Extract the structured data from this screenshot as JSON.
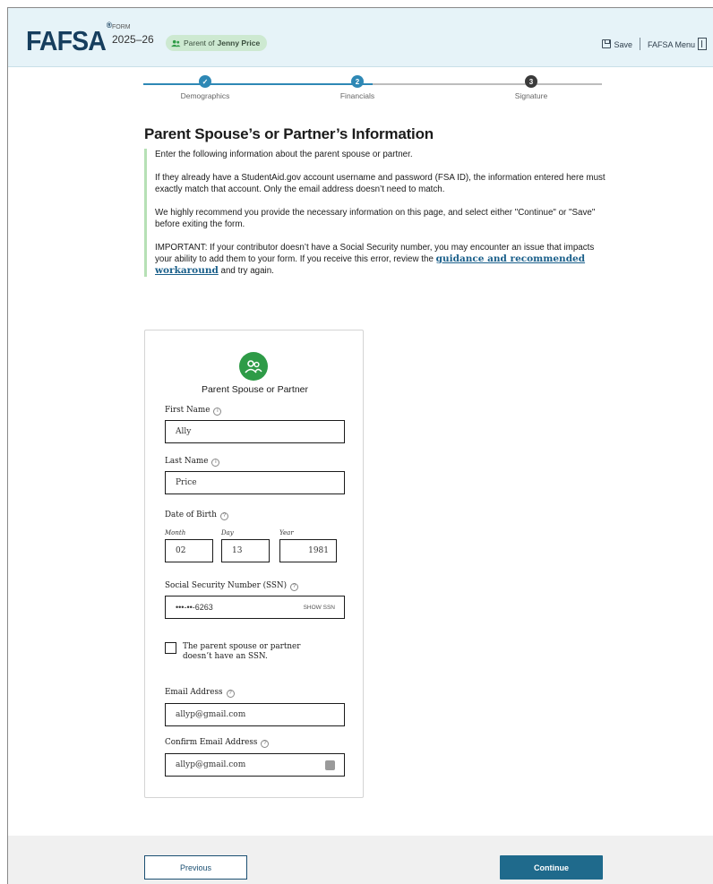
{
  "header": {
    "logo": "FAFSA",
    "logo_mark": "®",
    "form_label": "FORM",
    "form_year": "2025–26",
    "pill_prefix": "Parent of",
    "pill_name": "Jenny Price",
    "save_label": "Save",
    "menu_label": "FAFSA Menu"
  },
  "steps": [
    {
      "label": "Demographics",
      "marker": "✓",
      "state": "complete"
    },
    {
      "label": "Financials",
      "marker": "2",
      "state": "current"
    },
    {
      "label": "Signature",
      "marker": "3",
      "state": "upcoming"
    }
  ],
  "page": {
    "title": "Parent Spouse’s or Partner’s Information",
    "intro_1": "Enter the following information about the parent spouse or partner.",
    "intro_2": "If they already have a StudentAid.gov account username and password (FSA ID), the information entered here must exactly match that account. Only the email address doesn’t need to match.",
    "intro_3": "We highly recommend you provide the necessary information on this page, and select either \"Continue\" or \"Save\" before exiting the form.",
    "intro_4_a": "IMPORTANT: If your contributor doesn’t have a Social Security number, you may encounter an issue that impacts your ability to add them to your form. If you receive this error, review the ",
    "intro_4_link": "guidance and recommended workaround",
    "intro_4_b": " and try again."
  },
  "card": {
    "title": "Parent Spouse or Partner",
    "first_name_label": "First Name",
    "first_name_value": "Ally",
    "last_name_label": "Last Name",
    "last_name_value": "Price",
    "dob_label": "Date of Birth",
    "month_label": "Month",
    "day_label": "Day",
    "year_label": "Year",
    "month_value": "02",
    "day_value": "13",
    "year_value": "1981",
    "ssn_label": "Social Security Number (SSN)",
    "ssn_value": "•••-••-6263",
    "ssn_toggle": "SHOW SSN",
    "no_ssn_label": "The parent spouse or partner doesn’t have an SSN.",
    "email_label": "Email Address",
    "email_value": "allyp@gmail.com",
    "confirm_email_label": "Confirm Email Address",
    "confirm_email_value": "allyp@gmail.com"
  },
  "footer": {
    "previous_label": "Previous",
    "continue_label": "Continue"
  },
  "colors": {
    "header_bg": "#e6f3f8",
    "step_complete": "#2e88b5",
    "step_current": "#2e88b5",
    "step_upcoming": "#3a3a3a",
    "avatar": "#2e9b47",
    "primary_button": "#1f6a8c"
  }
}
